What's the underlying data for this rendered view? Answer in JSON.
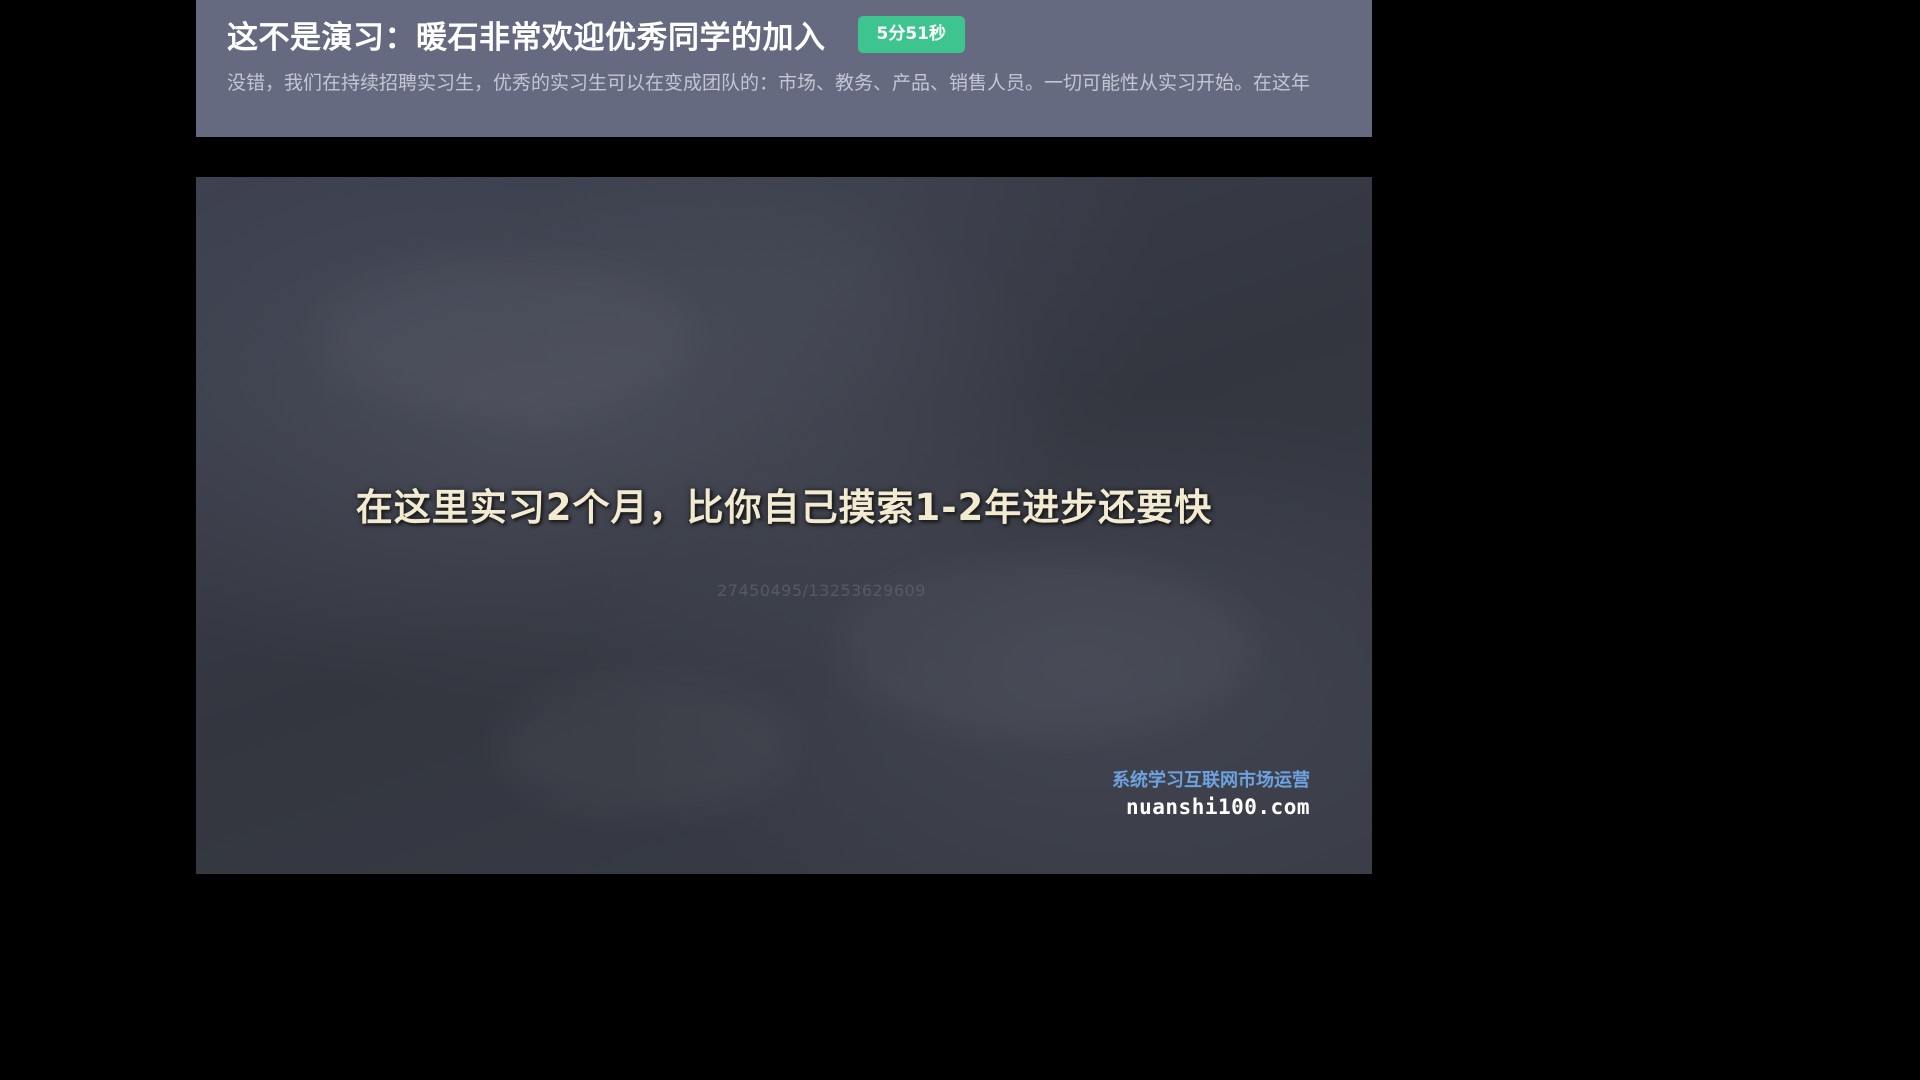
{
  "header": {
    "title": "这不是演习：暖石非常欢迎优秀同学的加入",
    "duration_badge": "5分51秒",
    "description": "没错，我们在持续招聘实习生，优秀的实习生可以在变成团队的：市场、教务、产品、销售人员。一切可能性从实习开始。在这年"
  },
  "video": {
    "caption": "在这里实习2个月，比你自己摸索1-2年进步还要快",
    "watermark_id": "27450495/13253629609",
    "brand": {
      "slogan": "系统学习互联网市场运营",
      "url": "nuanshi100.com"
    }
  },
  "colors": {
    "header_bg": "#656a80",
    "badge_bg": "#3ec58f",
    "caption_text": "#f3ead2",
    "brand_slogan": "#6ea2df"
  }
}
